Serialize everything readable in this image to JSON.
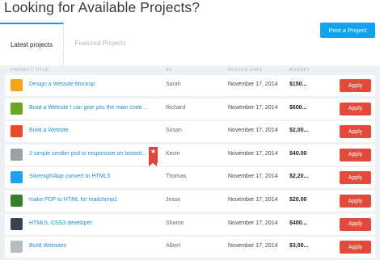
{
  "header": {
    "headline": "Looking for Available Projects?",
    "post_button": "Post a Project"
  },
  "tabs": [
    {
      "label": "Latest projects",
      "active": true
    },
    {
      "label": "Featured Projects",
      "active": false
    }
  ],
  "table": {
    "columns": [
      "PROJECT TITLE",
      "BY",
      "POSTED DATE",
      "BUDGET"
    ],
    "apply_label": "Apply",
    "rows": [
      {
        "title": "Design a Website Mockup",
        "by": "Sarah",
        "date": "November 17, 2014",
        "budget": "$150...",
        "thumb_color": "#f2a41c",
        "featured": false
      },
      {
        "title": "Build a Website I can give you the main code ...",
        "by": "Richard",
        "date": "November 17, 2014",
        "budget": "$600...",
        "thumb_color": "#6aa524",
        "featured": false
      },
      {
        "title": "Build a Website",
        "by": "Susan",
        "date": "November 17, 2014",
        "budget": "$2,00...",
        "thumb_color": "#e84a2b",
        "featured": false
      },
      {
        "title": "2 simple similler psd to responsive on bootstr...",
        "by": "Kevin",
        "date": "November 17, 2014",
        "budget": "$40.00",
        "thumb_color": "#9aa0a6",
        "featured": true
      },
      {
        "title": "SilverlightApp convert to HTML5",
        "by": "Thomas",
        "date": "November 17, 2014",
        "budget": "$2,20...",
        "thumb_color": "#1da1f2",
        "featured": false
      },
      {
        "title": "make PDF to HTML for mailchimp1",
        "by": "Jesse",
        "date": "November 17, 2014",
        "budget": "$20.00",
        "thumb_color": "#3b7d2a",
        "featured": false
      },
      {
        "title": "HTML5, CSS3 developer",
        "by": "Sharon",
        "date": "November 17, 2014",
        "budget": "$400...",
        "thumb_color": "#3a4250",
        "featured": false
      },
      {
        "title": "Build Websites",
        "by": "Albert",
        "date": "November 17, 2014",
        "budget": "$3,00...",
        "thumb_color": "#b7bcc1",
        "featured": false
      }
    ]
  },
  "colors": {
    "accent_blue": "#13a2ee",
    "apply_red": "#e24a3b",
    "link_blue": "#1e8fd6"
  }
}
